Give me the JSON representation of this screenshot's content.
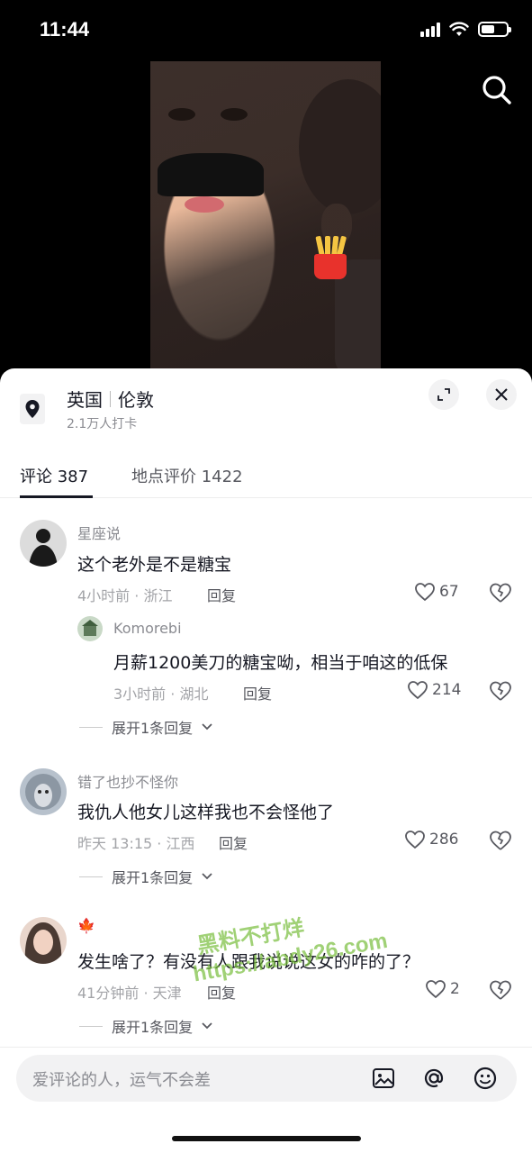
{
  "status_bar": {
    "time": "11:44"
  },
  "location": {
    "country": "英国",
    "city": "伦敦",
    "checkins": "2.1万人打卡"
  },
  "tabs": [
    {
      "label": "评论 387",
      "active": true
    },
    {
      "label": "地点评价 1422",
      "active": false
    }
  ],
  "comments": [
    {
      "username": "星座说",
      "text": "这个老外是不是糖宝",
      "meta": "4小时前 · 浙江",
      "reply_label": "回复",
      "likes": "67",
      "reply": {
        "username": "Komorebi",
        "text": "月薪1200美刀的糖宝呦，相当于咱这的低保",
        "meta": "3小时前 · 湖北",
        "reply_label": "回复",
        "likes": "214"
      },
      "expand": "展开1条回复"
    },
    {
      "username": "错了也抄不怪你",
      "text": "我仇人他女儿这样我也不会怪他了",
      "meta": "昨天 13:15 · 江西",
      "reply_label": "回复",
      "likes": "286",
      "expand": "展开1条回复"
    },
    {
      "username": "🍁",
      "text": "发生啥了？有没有人跟我说说这女的咋的了？",
      "meta": "41分钟前 · 天津",
      "reply_label": "回复",
      "likes": "2",
      "expand": "展开1条回复"
    }
  ],
  "input": {
    "placeholder": "爱评论的人，运气不会差"
  },
  "watermark": {
    "line1": "黑料不打烊",
    "line2": "https://abdy26.com"
  },
  "colors": {
    "text": "#161823",
    "muted": "#8a8b91",
    "panel_bg": "#ffffff",
    "input_bg": "#f2f2f3"
  }
}
